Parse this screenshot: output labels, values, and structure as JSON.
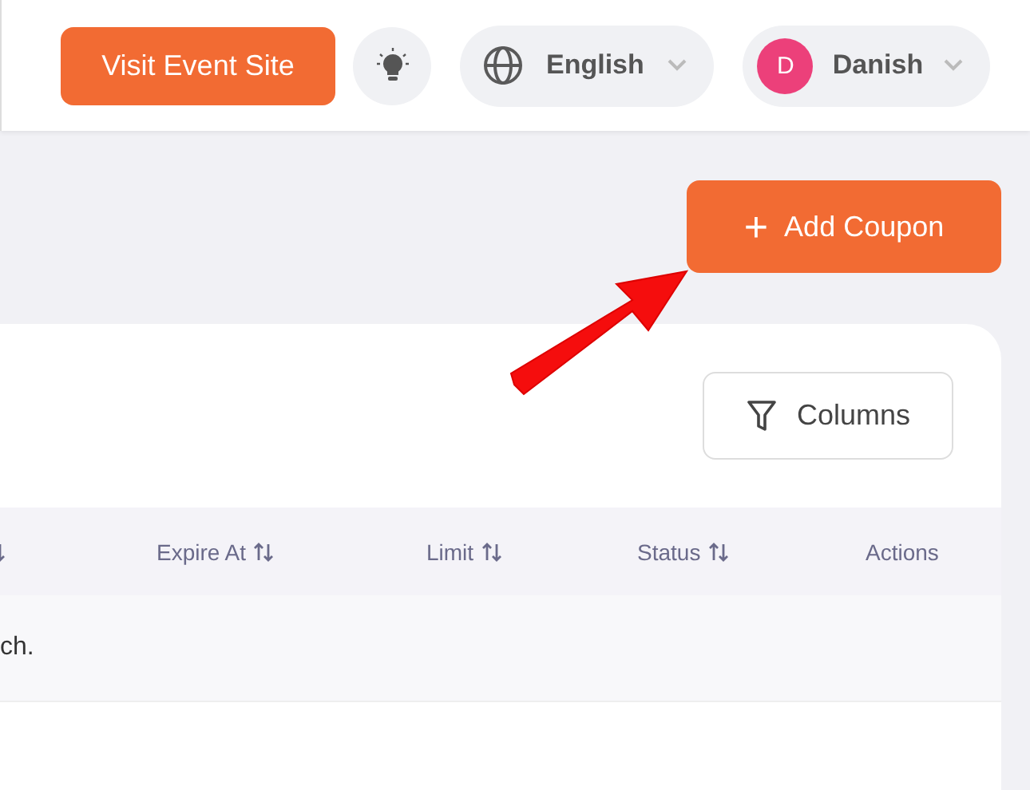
{
  "header": {
    "visit_button": "Visit Event Site",
    "language": {
      "label": "English"
    },
    "user": {
      "initial": "D",
      "name": "Danish",
      "color": "#ec407a"
    }
  },
  "add_button": {
    "icon": "+",
    "label": "Add Coupon"
  },
  "columns_button": {
    "label": "Columns"
  },
  "table": {
    "columns": [
      {
        "sortable": true
      },
      {
        "label": "Expire At",
        "sortable": true
      },
      {
        "label": "Limit",
        "sortable": true
      },
      {
        "label": "Status",
        "sortable": true
      },
      {
        "label": "Actions",
        "sortable": false
      }
    ],
    "empty_message": "ch."
  }
}
